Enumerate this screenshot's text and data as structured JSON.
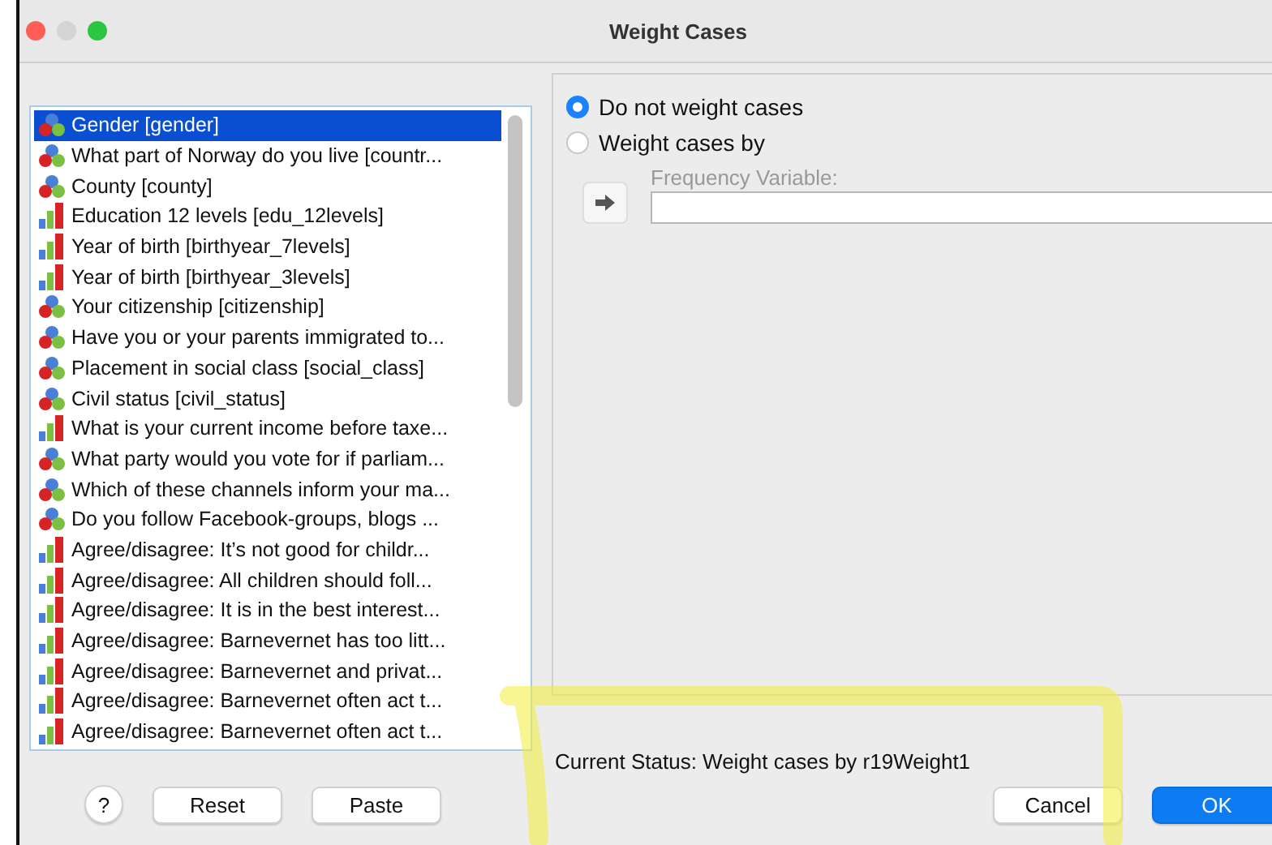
{
  "window": {
    "title": "Weight Cases"
  },
  "variables": [
    {
      "label": "Gender [gender]",
      "kind": "nominal",
      "selected": true
    },
    {
      "label": "What part of Norway do you live [countr...",
      "kind": "nominal",
      "selected": false
    },
    {
      "label": "County [county]",
      "kind": "nominal",
      "selected": false
    },
    {
      "label": "Education 12 levels [edu_12levels]",
      "kind": "ordinal",
      "selected": false
    },
    {
      "label": "Year of birth [birthyear_7levels]",
      "kind": "ordinal",
      "selected": false
    },
    {
      "label": "Year of birth [birthyear_3levels]",
      "kind": "ordinal",
      "selected": false
    },
    {
      "label": "Your citizenship [citizenship]",
      "kind": "nominal",
      "selected": false
    },
    {
      "label": "Have you or your parents immigrated to...",
      "kind": "nominal",
      "selected": false
    },
    {
      "label": "Placement in social class [social_class]",
      "kind": "nominal",
      "selected": false
    },
    {
      "label": "Civil status [civil_status]",
      "kind": "nominal",
      "selected": false
    },
    {
      "label": "What is your current income before taxe...",
      "kind": "ordinal",
      "selected": false
    },
    {
      "label": "What party would you vote for if parliam...",
      "kind": "nominal",
      "selected": false
    },
    {
      "label": "Which of these channels inform your ma...",
      "kind": "nominal",
      "selected": false
    },
    {
      "label": "Do you follow Facebook-groups, blogs ...",
      "kind": "nominal",
      "selected": false
    },
    {
      "label": "Agree/disagree: It’s not good for childr...",
      "kind": "ordinal",
      "selected": false
    },
    {
      "label": "Agree/disagree: All children should foll...",
      "kind": "ordinal",
      "selected": false
    },
    {
      "label": "Agree/disagree: It is in the best interest...",
      "kind": "ordinal",
      "selected": false
    },
    {
      "label": "Agree/disagree: Barnevernet has too litt...",
      "kind": "ordinal",
      "selected": false
    },
    {
      "label": "Agree/disagree: Barnevernet and privat...",
      "kind": "ordinal",
      "selected": false
    },
    {
      "label": "Agree/disagree: Barnevernet often act t...",
      "kind": "ordinal",
      "selected": false
    },
    {
      "label": "Agree/disagree: Barnevernet often act t...",
      "kind": "ordinal",
      "selected": false
    }
  ],
  "weighting": {
    "options": [
      {
        "label": "Do not weight cases",
        "selected": true
      },
      {
        "label": "Weight cases by",
        "selected": false
      }
    ],
    "frequency_variable": {
      "label": "Frequency Variable:",
      "disabled": true
    }
  },
  "status": "Current Status: Weight cases by r19Weight1",
  "buttons": [
    {
      "label": "?",
      "kind": "help"
    },
    {
      "label": "Reset",
      "kind": "plain"
    },
    {
      "label": "Paste",
      "kind": "plain"
    },
    {
      "label": "Cancel",
      "kind": "plain"
    },
    {
      "label": "OK",
      "kind": "default"
    }
  ]
}
